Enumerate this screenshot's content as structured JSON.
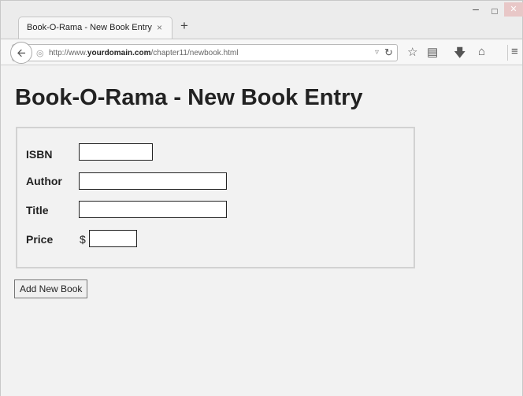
{
  "browser": {
    "tab_title": "Book-O-Rama - New Book Entry",
    "tab_close_glyph": "×",
    "new_tab_glyph": "+",
    "url_prefix": "http://www.",
    "url_domain": "yourdomain.com",
    "url_path": "/chapter11/newbook.html",
    "icons": [
      "back-arrow-icon",
      "globe-icon",
      "dropdown-icon",
      "reload-icon",
      "star-icon",
      "clipboard-icon",
      "download-icon",
      "home-icon",
      "menu-icon"
    ]
  },
  "page": {
    "heading": "Book-O-Rama - New Book Entry",
    "fields": {
      "isbn_label": "ISBN",
      "author_label": "Author",
      "title_label": "Title",
      "price_label": "Price",
      "currency": "$"
    },
    "submit_label": "Add New Book"
  },
  "colors": {
    "page_bg": "#f2f2f2",
    "border": "#d2d2d2",
    "text": "#222222"
  }
}
